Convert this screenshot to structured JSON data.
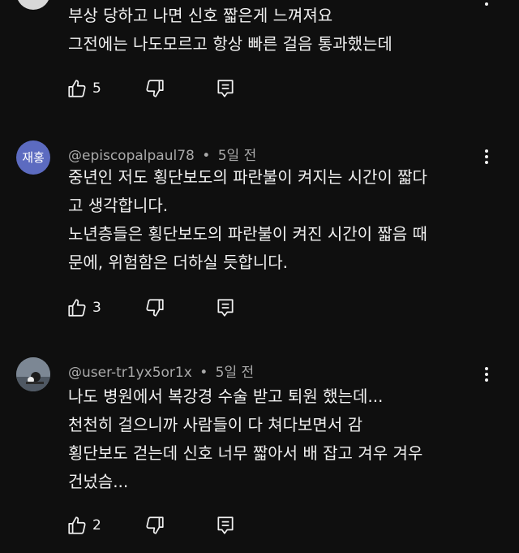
{
  "comments": [
    {
      "author": "",
      "time": "",
      "lines": [
        "부상 당하고 나면 신호 짧은게 느껴져요",
        "그전에는 나도모르고 항상 빠른 걸음 통과했는데"
      ],
      "likes": "5"
    },
    {
      "avatar_text": "재홍",
      "avatar_color": "#5c6bc0",
      "author": "@episcopalpaul78",
      "separator": "•",
      "time": "5일 전",
      "lines": [
        "중년인 저도 횡단보도의 파란불이 켜지는 시간이 짧다",
        "고 생각합니다.",
        "노년층들은 횡단보도의 파란불이 켜진 시간이 짧음 때",
        "문에, 위험함은 더하실 듯합니다."
      ],
      "likes": "3"
    },
    {
      "author": "@user-tr1yx5or1x",
      "separator": "•",
      "time": "5일 전",
      "lines": [
        "나도 병원에서 복강경 수술 받고 퇴원 했는데...",
        "천천히 걸으니까 사람들이 다 쳐다보면서 감",
        "횡단보도 걷는데 신호 너무 짧아서 배 잡고 겨우 겨우",
        "건넜슴..."
      ],
      "likes": "2"
    }
  ],
  "icons": {
    "like": "thumb-up-icon",
    "dislike": "thumb-down-icon",
    "reply": "reply-comment-icon",
    "more": "more-vert-icon"
  },
  "colors": {
    "background": "#0f0f0f",
    "text": "#f1f1f1",
    "meta": "#aaaaaa"
  }
}
